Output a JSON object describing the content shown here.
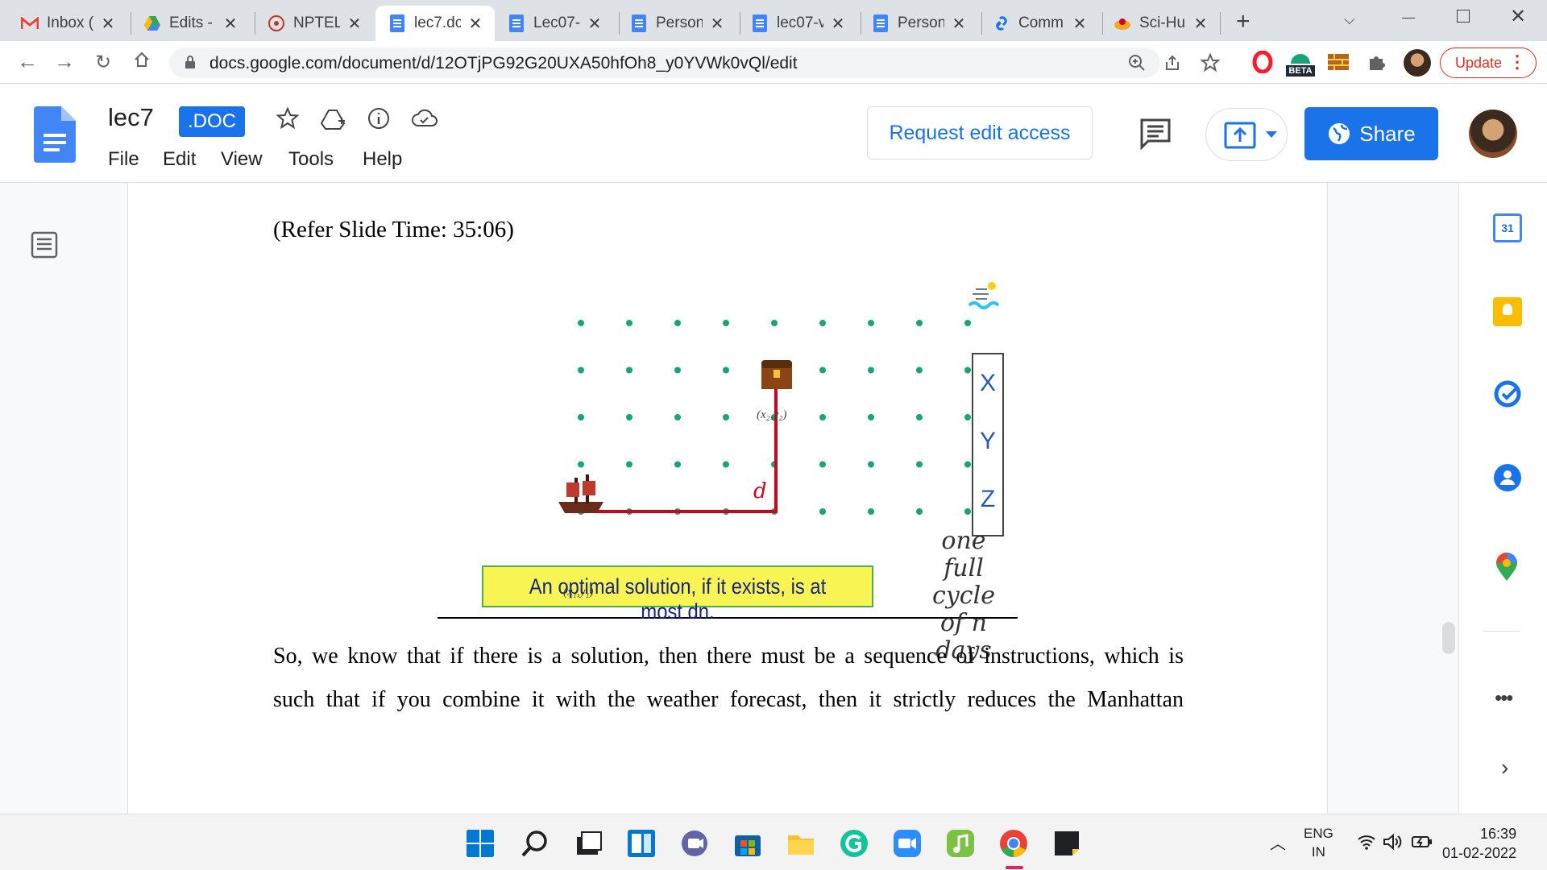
{
  "browser": {
    "tabs": [
      {
        "label": "Inbox (",
        "icon": "gmail-icon"
      },
      {
        "label": "Edits -",
        "icon": "drive-icon"
      },
      {
        "label": "NPTEL",
        "icon": "nptel-icon"
      },
      {
        "label": "lec7.dc",
        "icon": "docs-icon",
        "active": true
      },
      {
        "label": "Lec07-",
        "icon": "docs-icon"
      },
      {
        "label": "Person",
        "icon": "docs-icon"
      },
      {
        "label": "lec07-v",
        "icon": "docs-icon"
      },
      {
        "label": "Person",
        "icon": "docs-icon"
      },
      {
        "label": "Comm",
        "icon": "link-icon"
      },
      {
        "label": "Sci-Hu",
        "icon": "scihub-icon"
      }
    ],
    "url": "docs.google.com/document/d/12OTjPG92G20UXA50hfOh8_y0YVWk0vQl/edit",
    "update_label": "Update",
    "beta_label": "BETA"
  },
  "doc": {
    "title": "lec7",
    "badge": ".DOC",
    "menus": [
      "File",
      "Edit",
      "View",
      "Tools",
      "Help"
    ],
    "request_edit_label": "Request edit access",
    "share_label": "Share"
  },
  "body": {
    "caption": "(Refer Slide Time: 35:06)",
    "slide": {
      "point_end_label": "(x₂,y₂)",
      "point_start_label": "(x₁,y₁)",
      "distance_label": "d",
      "forecast_letters": [
        "X",
        "Y",
        "Z"
      ],
      "handwritten_note": [
        "one",
        "full",
        "cycle",
        "of n days"
      ],
      "highlight_text": "An optimal solution, if it exists, is at most dn."
    },
    "paragraph_line1": "So, we know that if there is a solution, then there must be a sequence of instructions, which is",
    "paragraph_line2": "such that if you combine it with the weather forecast, then it strictly reduces the Manhattan"
  },
  "taskbar": {
    "language": "ENG",
    "region": "IN",
    "time": "16:39",
    "date": "01-02-2022"
  },
  "colors": {
    "accent": "#1a73e8",
    "grid_dot": "#1aa37a",
    "path_red": "#d0021b",
    "highlight": "#f7f453"
  }
}
